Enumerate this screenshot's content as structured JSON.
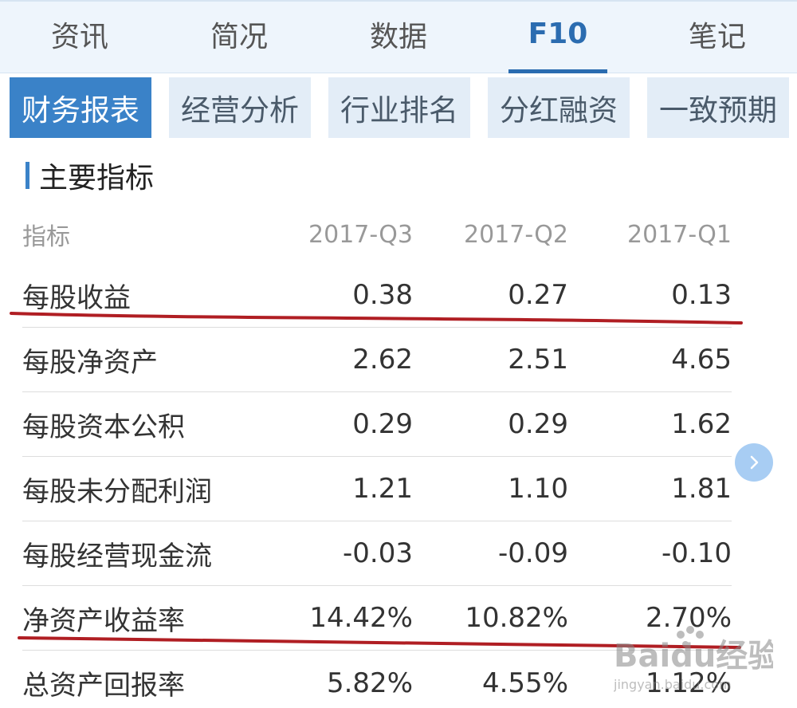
{
  "top_tabs": [
    {
      "label": "资讯",
      "active": false
    },
    {
      "label": "简况",
      "active": false
    },
    {
      "label": "数据",
      "active": false
    },
    {
      "label": "F10",
      "active": true
    },
    {
      "label": "笔记",
      "active": false
    }
  ],
  "sub_tabs": [
    {
      "label": "财务报表",
      "active": true
    },
    {
      "label": "经营分析",
      "active": false
    },
    {
      "label": "行业排名",
      "active": false
    },
    {
      "label": "分红融资",
      "active": false
    },
    {
      "label": "一致预期",
      "active": false
    }
  ],
  "section": {
    "title": "主要指标"
  },
  "table": {
    "headers": [
      "指标",
      "2017-Q3",
      "2017-Q2",
      "2017-Q1"
    ],
    "rows": [
      {
        "name": "每股收益",
        "values": [
          "0.38",
          "0.27",
          "0.13"
        ],
        "underlined": true
      },
      {
        "name": "每股净资产",
        "values": [
          "2.62",
          "2.51",
          "4.65"
        ],
        "underlined": false
      },
      {
        "name": "每股资本公积",
        "values": [
          "0.29",
          "0.29",
          "1.62"
        ],
        "underlined": false
      },
      {
        "name": "每股未分配利润",
        "values": [
          "1.21",
          "1.10",
          "1.81"
        ],
        "underlined": false
      },
      {
        "name": "每股经营现金流",
        "values": [
          "-0.03",
          "-0.09",
          "-0.10"
        ],
        "underlined": false
      },
      {
        "name": "净资产收益率",
        "values": [
          "14.42%",
          "10.82%",
          "2.70%"
        ],
        "underlined": true
      },
      {
        "name": "总资产回报率",
        "values": [
          "5.82%",
          "4.55%",
          "1.12%"
        ],
        "underlined": false
      }
    ]
  },
  "watermark": {
    "brand": "Baidu经验",
    "url": "jingyan.baidu.com"
  },
  "colors": {
    "accent": "#3a82c8",
    "annotation": "#b01e23"
  },
  "icons": {
    "next": "chevron-right-icon"
  }
}
